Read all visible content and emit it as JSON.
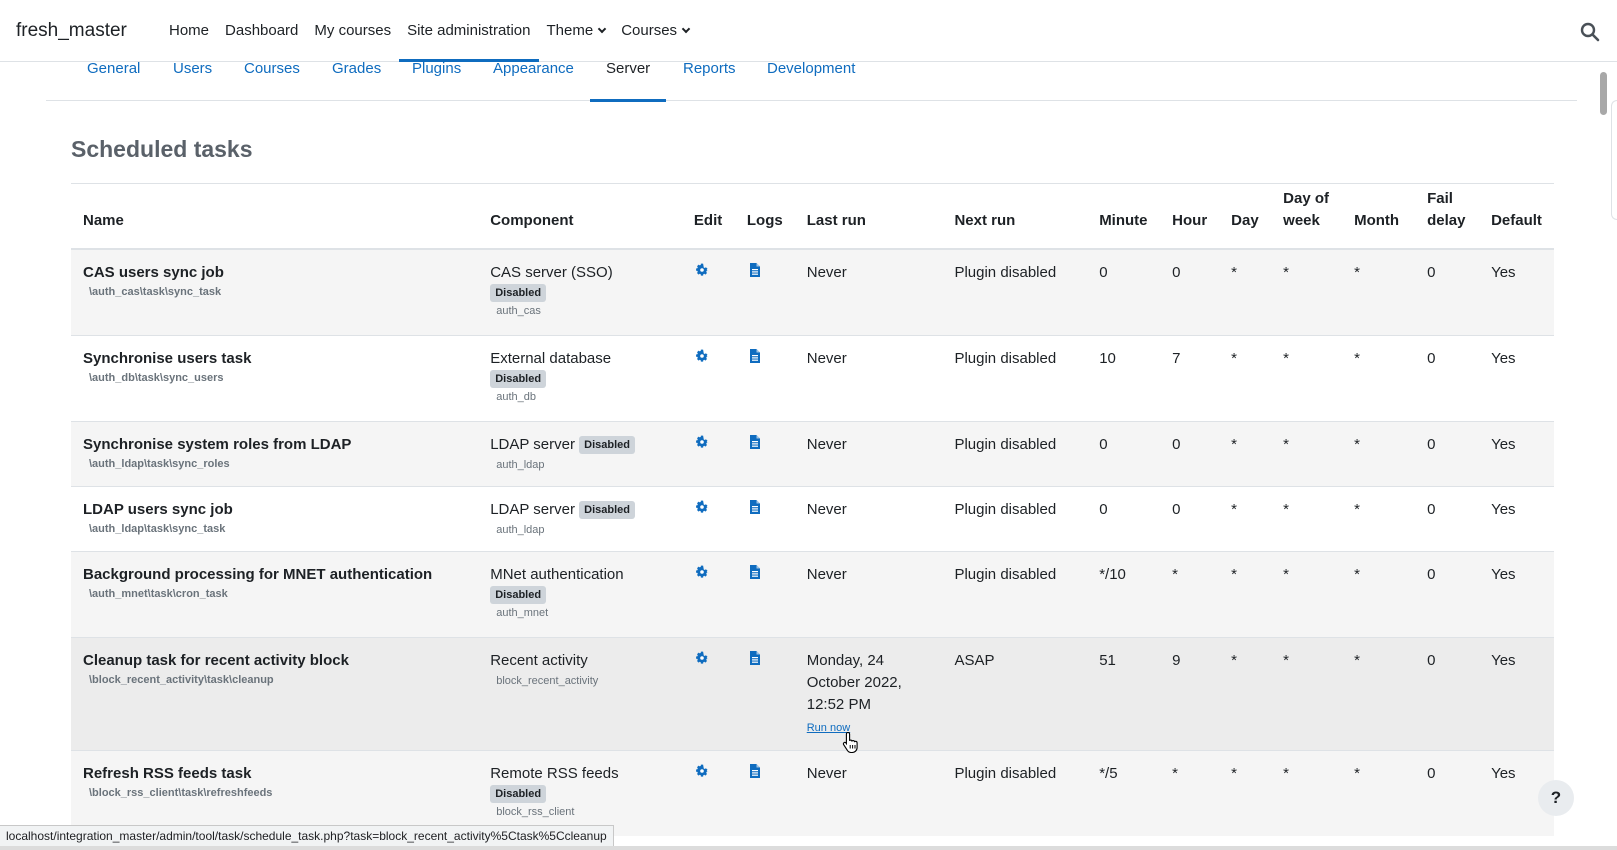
{
  "navbar": {
    "brand": "fresh_master",
    "links": [
      {
        "label": "Home"
      },
      {
        "label": "Dashboard"
      },
      {
        "label": "My courses"
      },
      {
        "label": "Site administration"
      },
      {
        "label": "Theme"
      },
      {
        "label": "Courses"
      }
    ],
    "search_icon": "search-icon"
  },
  "tabs": [
    {
      "label": "General"
    },
    {
      "label": "Users"
    },
    {
      "label": "Courses"
    },
    {
      "label": "Grades"
    },
    {
      "label": "Plugins"
    },
    {
      "label": "Appearance"
    },
    {
      "label": "Server"
    },
    {
      "label": "Reports"
    },
    {
      "label": "Development"
    }
  ],
  "page": {
    "title": "Scheduled tasks"
  },
  "table": {
    "headers": {
      "name": "Name",
      "component": "Component",
      "edit": "Edit",
      "logs": "Logs",
      "last_run": "Last run",
      "next_run": "Next run",
      "minute": "Minute",
      "hour": "Hour",
      "day": "Day",
      "day_of_week": "Day of week",
      "month": "Month",
      "fail_delay": "Fail delay",
      "default": "Default"
    },
    "run_now_label": "Run now",
    "disabled_label": "Disabled",
    "rows": [
      {
        "name": "CAS users sync job",
        "classname": "\\auth_cas\\task\\sync_task",
        "component": "CAS server (SSO)",
        "disabled": true,
        "plugin": "auth_cas",
        "last_run": "Never",
        "next_run": "Plugin disabled",
        "minute": "0",
        "hour": "0",
        "day": "*",
        "dow": "*",
        "month": "*",
        "fail_delay": "0",
        "default": "Yes"
      },
      {
        "name": "Synchronise users task",
        "classname": "\\auth_db\\task\\sync_users",
        "component": "External database",
        "disabled": true,
        "plugin": "auth_db",
        "last_run": "Never",
        "next_run": "Plugin disabled",
        "minute": "10",
        "hour": "7",
        "day": "*",
        "dow": "*",
        "month": "*",
        "fail_delay": "0",
        "default": "Yes"
      },
      {
        "name": "Synchronise system roles from LDAP",
        "classname": "\\auth_ldap\\task\\sync_roles",
        "component": "LDAP server",
        "disabled": true,
        "plugin": "auth_ldap",
        "last_run": "Never",
        "next_run": "Plugin disabled",
        "minute": "0",
        "hour": "0",
        "day": "*",
        "dow": "*",
        "month": "*",
        "fail_delay": "0",
        "default": "Yes"
      },
      {
        "name": "LDAP users sync job",
        "classname": "\\auth_ldap\\task\\sync_task",
        "component": "LDAP server",
        "disabled": true,
        "plugin": "auth_ldap",
        "last_run": "Never",
        "next_run": "Plugin disabled",
        "minute": "0",
        "hour": "0",
        "day": "*",
        "dow": "*",
        "month": "*",
        "fail_delay": "0",
        "default": "Yes"
      },
      {
        "name": "Background processing for MNET authentication",
        "classname": "\\auth_mnet\\task\\cron_task",
        "component": "MNet authentication",
        "disabled": true,
        "plugin": "auth_mnet",
        "last_run": "Never",
        "next_run": "Plugin disabled",
        "minute": "*/10",
        "hour": "*",
        "day": "*",
        "dow": "*",
        "month": "*",
        "fail_delay": "0",
        "default": "Yes"
      },
      {
        "name": "Cleanup task for recent activity block",
        "classname": "\\block_recent_activity\\task\\cleanup",
        "component": "Recent activity",
        "disabled": false,
        "plugin": "block_recent_activity",
        "last_run": "Monday, 24 October 2022, 12:52 PM",
        "next_run": "ASAP",
        "minute": "51",
        "hour": "9",
        "day": "*",
        "dow": "*",
        "month": "*",
        "fail_delay": "0",
        "default": "Yes"
      },
      {
        "name": "Refresh RSS feeds task",
        "classname": "\\block_rss_client\\task\\refreshfeeds",
        "component": "Remote RSS feeds",
        "disabled": true,
        "plugin": "block_rss_client",
        "last_run": "Never",
        "next_run": "Plugin disabled",
        "minute": "*/5",
        "hour": "*",
        "day": "*",
        "dow": "*",
        "month": "*",
        "fail_delay": "0",
        "default": "Yes"
      }
    ]
  },
  "help_button": "?",
  "status_url": "localhost/integration_master/admin/tool/task/schedule_task.php?task=block_recent_activity%5Ctask%5Ccleanup",
  "colors": {
    "link": "#0f6cbf",
    "title_gray": "#5a6169",
    "badge": "#ced4da"
  }
}
